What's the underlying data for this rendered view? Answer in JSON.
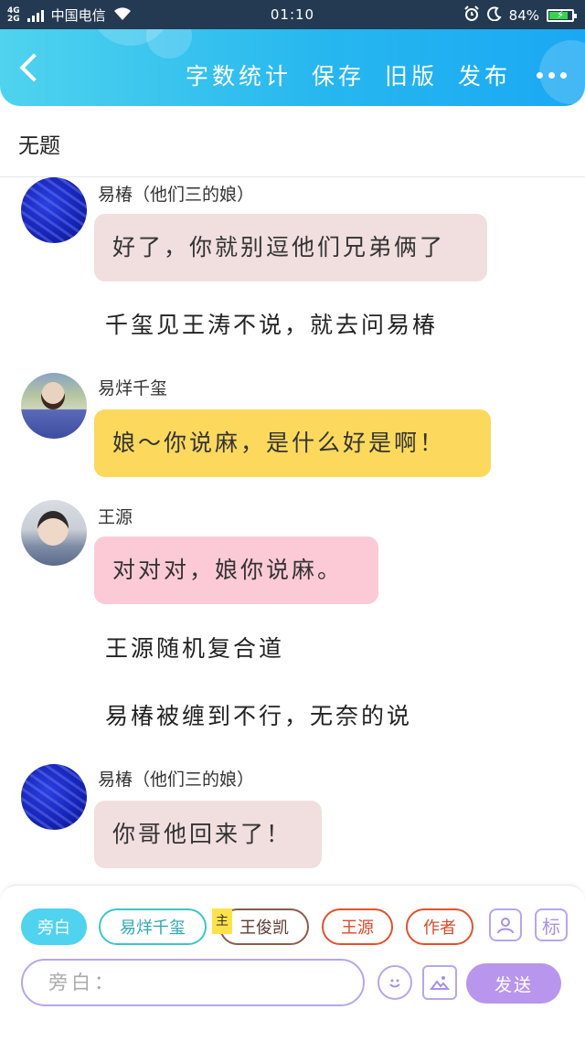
{
  "status_bar": {
    "network": "4G\n2G",
    "carrier": "中国电信",
    "time": "01:10",
    "battery": "84%",
    "battery_level": 0.84
  },
  "nav": {
    "actions": [
      "字数统计",
      "保存",
      "旧版",
      "发布"
    ]
  },
  "document": {
    "title": "无题"
  },
  "messages": [
    {
      "type": "dialogue",
      "speaker": "易椿（他们三的娘）",
      "avatar": "blue-fabric-avatar",
      "text": "好了，你就别逗他们兄弟俩了",
      "bubble_color": "#f1dede"
    },
    {
      "type": "narration",
      "text": "千玺见王涛不说，就去问易椿"
    },
    {
      "type": "dialogue",
      "speaker": "易烊千玺",
      "avatar": "costume-photo-avatar",
      "text": "娘～你说麻，是什么好是啊！",
      "bubble_color": "#fcd95c"
    },
    {
      "type": "dialogue",
      "speaker": "王源",
      "avatar": "portrait-photo-avatar",
      "text": "对对对，娘你说麻。",
      "bubble_color": "#fccad6"
    },
    {
      "type": "narration",
      "text": "王源随机复合道"
    },
    {
      "type": "narration",
      "text": "易椿被缠到不行，无奈的说"
    },
    {
      "type": "dialogue",
      "speaker": "易椿（他们三的娘）",
      "avatar": "blue-fabric-avatar",
      "text": "你哥他回来了！",
      "bubble_color": "#f1dede"
    }
  ],
  "composer": {
    "roles": [
      "旁白",
      "易烊千玺",
      "王俊凯",
      "王源",
      "作者"
    ],
    "main_tag": "主",
    "active_role": "旁白",
    "input_placeholder": "旁白：",
    "side_tool_label": "标",
    "send_label": "发送"
  }
}
